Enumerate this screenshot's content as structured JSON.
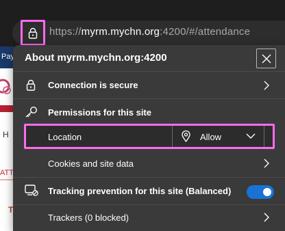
{
  "browser": {
    "url_scheme": "https://",
    "url_host": "myrm.mychn.org",
    "url_rest": ":4200/#/attendance"
  },
  "background_page": {
    "pay_fragment": "Pay",
    "h_fragment": "H",
    "att_fragment": "ATT",
    "t_fragment": "T"
  },
  "site_info": {
    "title": "About myrm.mychn.org:4200",
    "connection_label": "Connection is secure",
    "permissions_heading": "Permissions for this site",
    "location_label": "Location",
    "location_value": "Allow",
    "cookies_label": "Cookies and site data",
    "tracking_label": "Tracking prevention for this site (Balanced)",
    "tracking_enabled": true,
    "trackers_label": "Trackers (0 blocked)"
  },
  "colors": {
    "highlight": "#ff6bf0",
    "toggle_on": "#1a72d6",
    "panel_bg": "#3a3a3a"
  }
}
